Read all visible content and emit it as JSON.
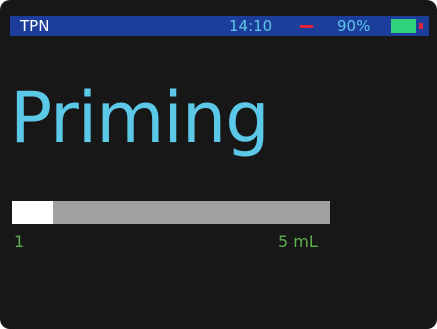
{
  "status_bar": {
    "app_name": "TPN",
    "time": "14:10",
    "alarm_indicator": "—",
    "battery_percent": "90%",
    "battery_level": 0.9,
    "battery_icon": "battery-icon",
    "background_color": "#1d3d9a",
    "alarm_color": "#e2233b",
    "battery_color": "#2fd17e"
  },
  "main": {
    "title": "Priming",
    "title_color": "#5cc8e8"
  },
  "progress": {
    "fraction": 0.13,
    "min_label": "1",
    "max_label": "5 mL",
    "label_color": "#5cb04e",
    "fill_color": "#ffffff",
    "track_color": "#a0a0a0"
  }
}
